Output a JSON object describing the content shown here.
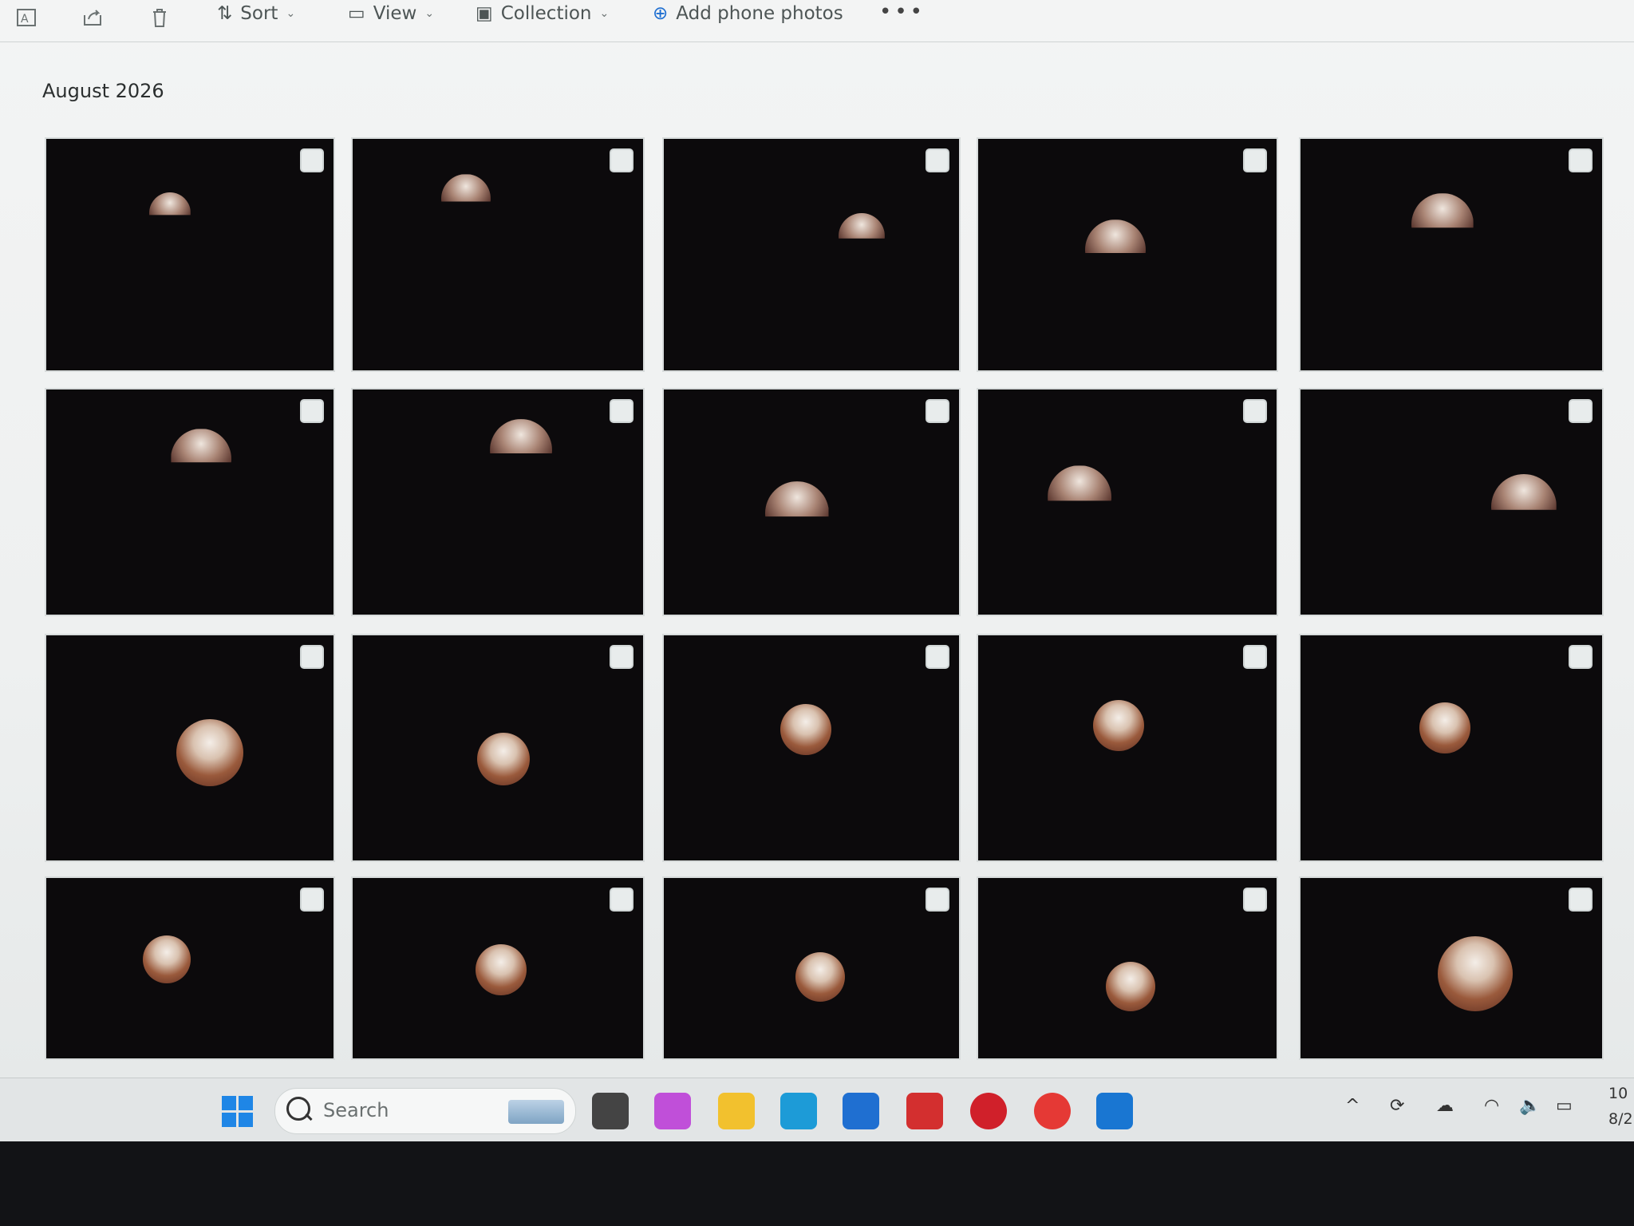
{
  "toolbar": {
    "items": [
      {
        "name": "rename-icon",
        "label": ""
      },
      {
        "name": "share-icon",
        "label": ""
      },
      {
        "name": "delete-icon",
        "label": ""
      }
    ],
    "sort_label": "Sort",
    "view_label": "View",
    "collection_label": "Collection",
    "add_phone_label": "Add phone photos",
    "more_label": "•••"
  },
  "gallery": {
    "group_title": "August 2026",
    "thumbnails": [
      {
        "type": "lunar-eclipse-photo"
      },
      {
        "type": "lunar-eclipse-photo"
      },
      {
        "type": "lunar-eclipse-photo"
      },
      {
        "type": "lunar-eclipse-photo"
      },
      {
        "type": "lunar-eclipse-photo"
      },
      {
        "type": "lunar-eclipse-photo"
      },
      {
        "type": "lunar-eclipse-photo"
      },
      {
        "type": "lunar-eclipse-photo"
      },
      {
        "type": "lunar-eclipse-photo"
      },
      {
        "type": "lunar-eclipse-photo"
      },
      {
        "type": "lunar-eclipse-photo"
      },
      {
        "type": "lunar-eclipse-photo"
      },
      {
        "type": "lunar-eclipse-photo"
      },
      {
        "type": "lunar-eclipse-photo"
      },
      {
        "type": "lunar-eclipse-photo"
      },
      {
        "type": "lunar-eclipse-photo"
      },
      {
        "type": "lunar-eclipse-photo"
      },
      {
        "type": "lunar-eclipse-photo"
      },
      {
        "type": "lunar-eclipse-photo"
      },
      {
        "type": "lunar-eclipse-photo"
      }
    ]
  },
  "taskbar": {
    "search_placeholder": "Search",
    "apps": [
      {
        "name": "task-view-icon",
        "color": "#444444"
      },
      {
        "name": "copilot-icon",
        "color": "#c04fd9"
      },
      {
        "name": "file-explorer-icon",
        "color": "#f2c12e"
      },
      {
        "name": "edge-icon",
        "color": "#1d9bd7"
      },
      {
        "name": "store-icon",
        "color": "#1f6fd1"
      },
      {
        "name": "lastpass-icon",
        "color": "#d32f2f"
      },
      {
        "name": "mcafee-icon",
        "color": "#d0202a"
      },
      {
        "name": "shopping-icon",
        "color": "#e53935"
      },
      {
        "name": "outlook-icon",
        "color": "#1976d2"
      }
    ],
    "tray": {
      "chevron": "^",
      "clock_time": "10",
      "clock_date": "8/2"
    }
  }
}
